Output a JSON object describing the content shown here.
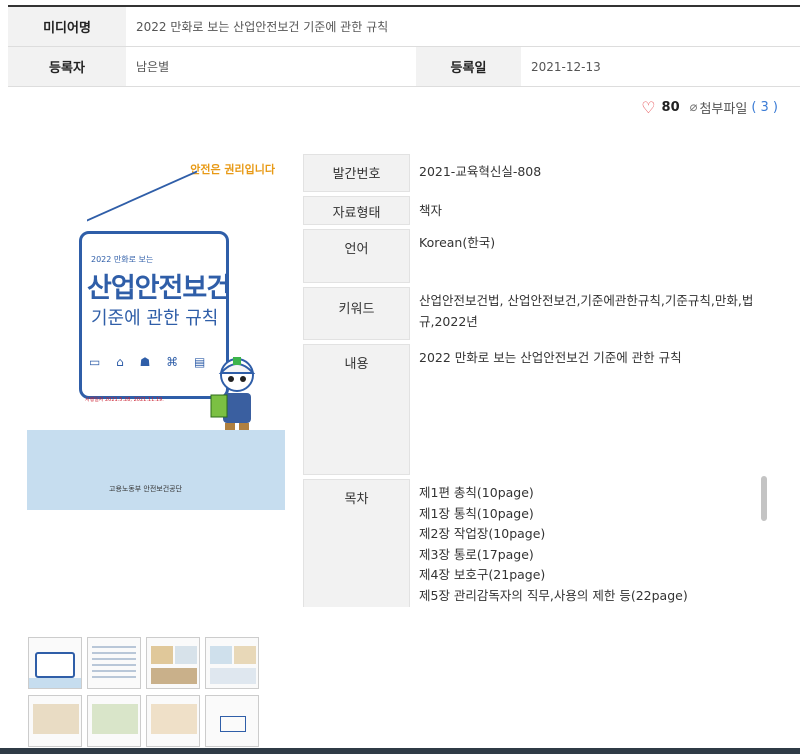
{
  "info": {
    "media_label": "미디어명",
    "media_value": "2022 만화로 보는 산업안전보건 기준에 관한 규칙",
    "author_label": "등록자",
    "author_value": "남은별",
    "date_label": "등록일",
    "date_value": "2021-12-13"
  },
  "meta": {
    "like_count": "80",
    "attach_label": "첨부파일",
    "attach_count": "( 3 )"
  },
  "cover": {
    "top_logo": "안전은 권리입니다",
    "subtitle": "2022 만화로 보는",
    "title": "산업안전보건",
    "title2": "기준에 관한 규칙",
    "date_note": "시행일자 2021.5.28, 2021.11.19.",
    "footer": "고용노동부  안전보건공단"
  },
  "details": [
    {
      "label": "발간번호",
      "value": "2021-교육혁신실-808"
    },
    {
      "label": "자료형태",
      "value": "책자"
    },
    {
      "label": "언어",
      "value": "Korean(한국)"
    },
    {
      "label": "키워드",
      "value": "산업안전보건법, 산업안전보건,기준에관한규칙,기준규칙,만화,법규,2022년"
    },
    {
      "label": "내용",
      "value": "2022 만화로 보는 산업안전보건 기준에 관한 규칙"
    }
  ],
  "toc": {
    "label": "목차",
    "items": [
      "제1편 총칙(10page)",
      "제1장 통칙(10page)",
      "제2장 작업장(10page)",
      "제3장 통로(17page)",
      "제4장 보호구(21page)",
      "제5장 관리감독자의 직무,사용의 제한 등(22page)"
    ]
  },
  "colors": {
    "heart": "#e5484d",
    "link": "#3a7bd5",
    "cover_blue": "#2f5ea8",
    "footer_band": "#2f3b46"
  }
}
